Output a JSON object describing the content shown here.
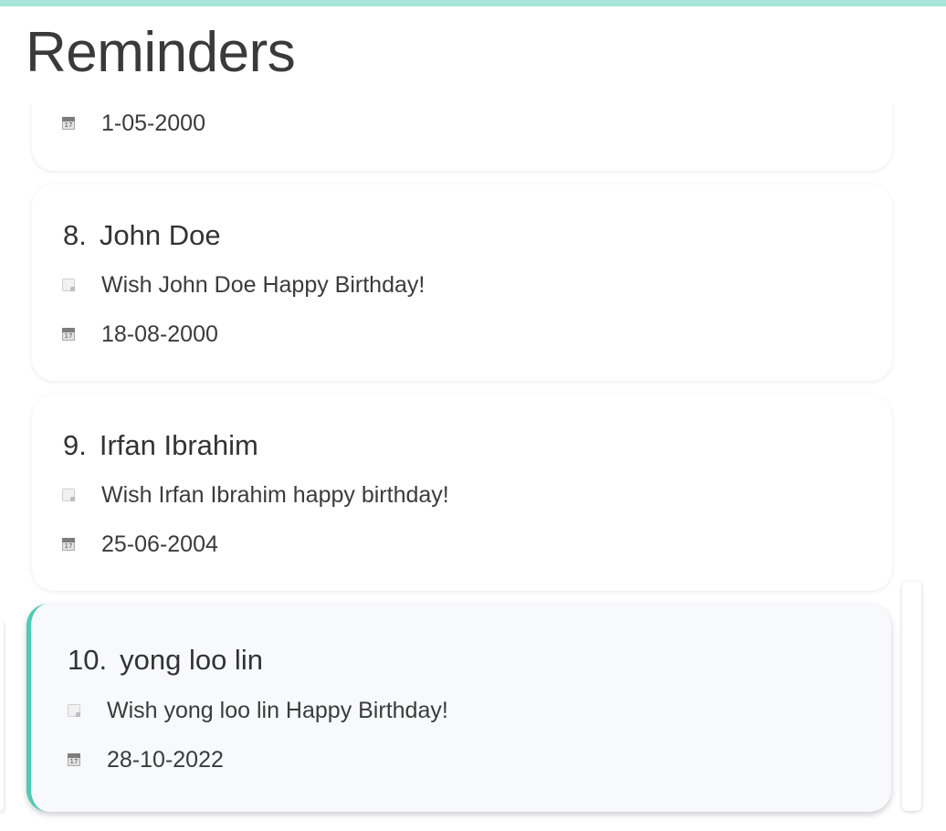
{
  "panel": {
    "title": "Reminders"
  },
  "theme": {
    "accent": "#4dcbb4",
    "top_bar": "#a6e5d8",
    "selected_card_bg": "#f8f9fc"
  },
  "icons": {
    "note": "note-icon",
    "calendar": "calendar-icon",
    "calendar_day": "17"
  },
  "reminders": [
    {
      "date": "1-05-2000"
    },
    {
      "index": "8.",
      "name": "John Doe",
      "message": "Wish John Doe Happy Birthday!",
      "date": "18-08-2000"
    },
    {
      "index": "9.",
      "name": "Irfan Ibrahim",
      "message": "Wish Irfan Ibrahim happy birthday!",
      "date": "25-06-2004"
    },
    {
      "index": "10.",
      "name": "yong loo lin",
      "message": "Wish yong loo lin Happy Birthday!",
      "date": "28-10-2022",
      "selected": true
    }
  ]
}
